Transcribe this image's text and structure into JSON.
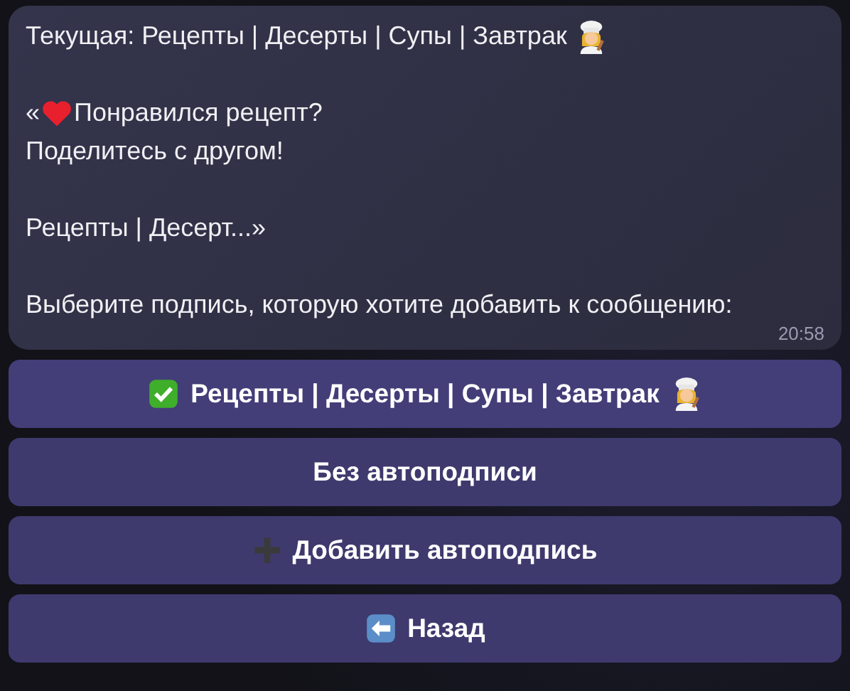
{
  "message": {
    "header": "Текущая: Рецепты | Десерты | Супы | Завтрак",
    "quote_open": "«",
    "quote_first": "Понравился рецепт?",
    "quote_second": "Поделитесь с другом!",
    "quote_tail": "Рецепты | Десерт...»",
    "prompt": "Выберите подпись, которую хотите добавить к сообщению:",
    "time": "20:58"
  },
  "buttons": [
    {
      "label": "Рецепты | Десерты | Супы | Завтрак",
      "selected": true
    },
    {
      "label": "Без автоподписи",
      "selected": false
    },
    {
      "label": "Добавить автоподпись",
      "selected": false
    },
    {
      "label": "Назад",
      "selected": false
    }
  ]
}
